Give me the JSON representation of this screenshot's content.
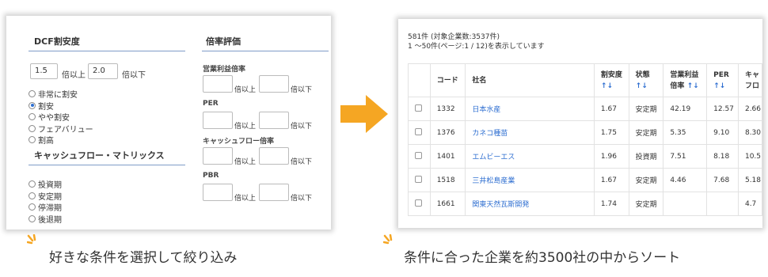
{
  "left": {
    "dcf_title": "DCF割安度",
    "ratio_title": "倍率評価",
    "min_value": "1.5",
    "min_suffix": "倍以上",
    "max_value": "2.0",
    "max_suffix": "倍以下",
    "dcf_options": [
      {
        "label": "非常に割安",
        "selected": false
      },
      {
        "label": "割安",
        "selected": true
      },
      {
        "label": "やや割安",
        "selected": false
      },
      {
        "label": "フェアバリュー",
        "selected": false
      },
      {
        "label": "割高",
        "selected": false
      }
    ],
    "cash_title": "キャッシュフロー・マトリックス",
    "cash_options": [
      {
        "label": "投資期",
        "selected": false
      },
      {
        "label": "安定期",
        "selected": false
      },
      {
        "label": "停滞期",
        "selected": false
      },
      {
        "label": "後退期",
        "selected": false
      }
    ],
    "ratios": [
      {
        "label": "営業利益倍率",
        "min_suffix": "倍以上",
        "max_suffix": "倍以下"
      },
      {
        "label": "PER",
        "min_suffix": "倍以上",
        "max_suffix": "倍以下"
      },
      {
        "label": "キャッシュフロー倍率",
        "min_suffix": "倍以上",
        "max_suffix": "倍以下"
      },
      {
        "label": "PBR",
        "min_suffix": "倍以上",
        "max_suffix": "倍以下"
      }
    ]
  },
  "right": {
    "count_line": "581件 (対象企業数:3537件)",
    "range_line": "1 〜50件(ページ:1 / 12)を表示しています",
    "headers": [
      "コード",
      "社名",
      "割安度",
      "状態",
      "営業利益",
      "PER",
      "キャ"
    ],
    "header_sub": {
      "discount": "↑↓",
      "status": "↑↓",
      "op_profit": "倍率",
      "op_profit_sort": "↑↓",
      "per": "↑↓",
      "cash": "フロ"
    },
    "rows": [
      {
        "code": "1332",
        "name": "日本水産",
        "discount": "1.67",
        "status": "安定期",
        "op": "42.19",
        "per": "12.57",
        "cash": "2.66"
      },
      {
        "code": "1376",
        "name": "カネコ種苗",
        "discount": "1.75",
        "status": "安定期",
        "op": "5.35",
        "per": "9.10",
        "cash": "8.30"
      },
      {
        "code": "1401",
        "name": "エムビーエス",
        "discount": "1.96",
        "status": "投資期",
        "op": "7.51",
        "per": "8.18",
        "cash": "10.5"
      },
      {
        "code": "1518",
        "name": "三井松島産業",
        "discount": "1.67",
        "status": "安定期",
        "op": "4.46",
        "per": "7.68",
        "cash": "5.18"
      },
      {
        "code": "1661",
        "name": "関東天然瓦斯開発",
        "discount": "1.74",
        "status": "安定期",
        "op": "",
        "per": "",
        "cash": "4.7"
      }
    ]
  },
  "captions": {
    "left": "好きな条件を選択して絞り込み",
    "right": "条件に合った企業を約3500社の中からソート"
  },
  "colors": {
    "accent": "#f5a623",
    "link": "#2f6fd1",
    "rule": "#7f9cc8"
  }
}
